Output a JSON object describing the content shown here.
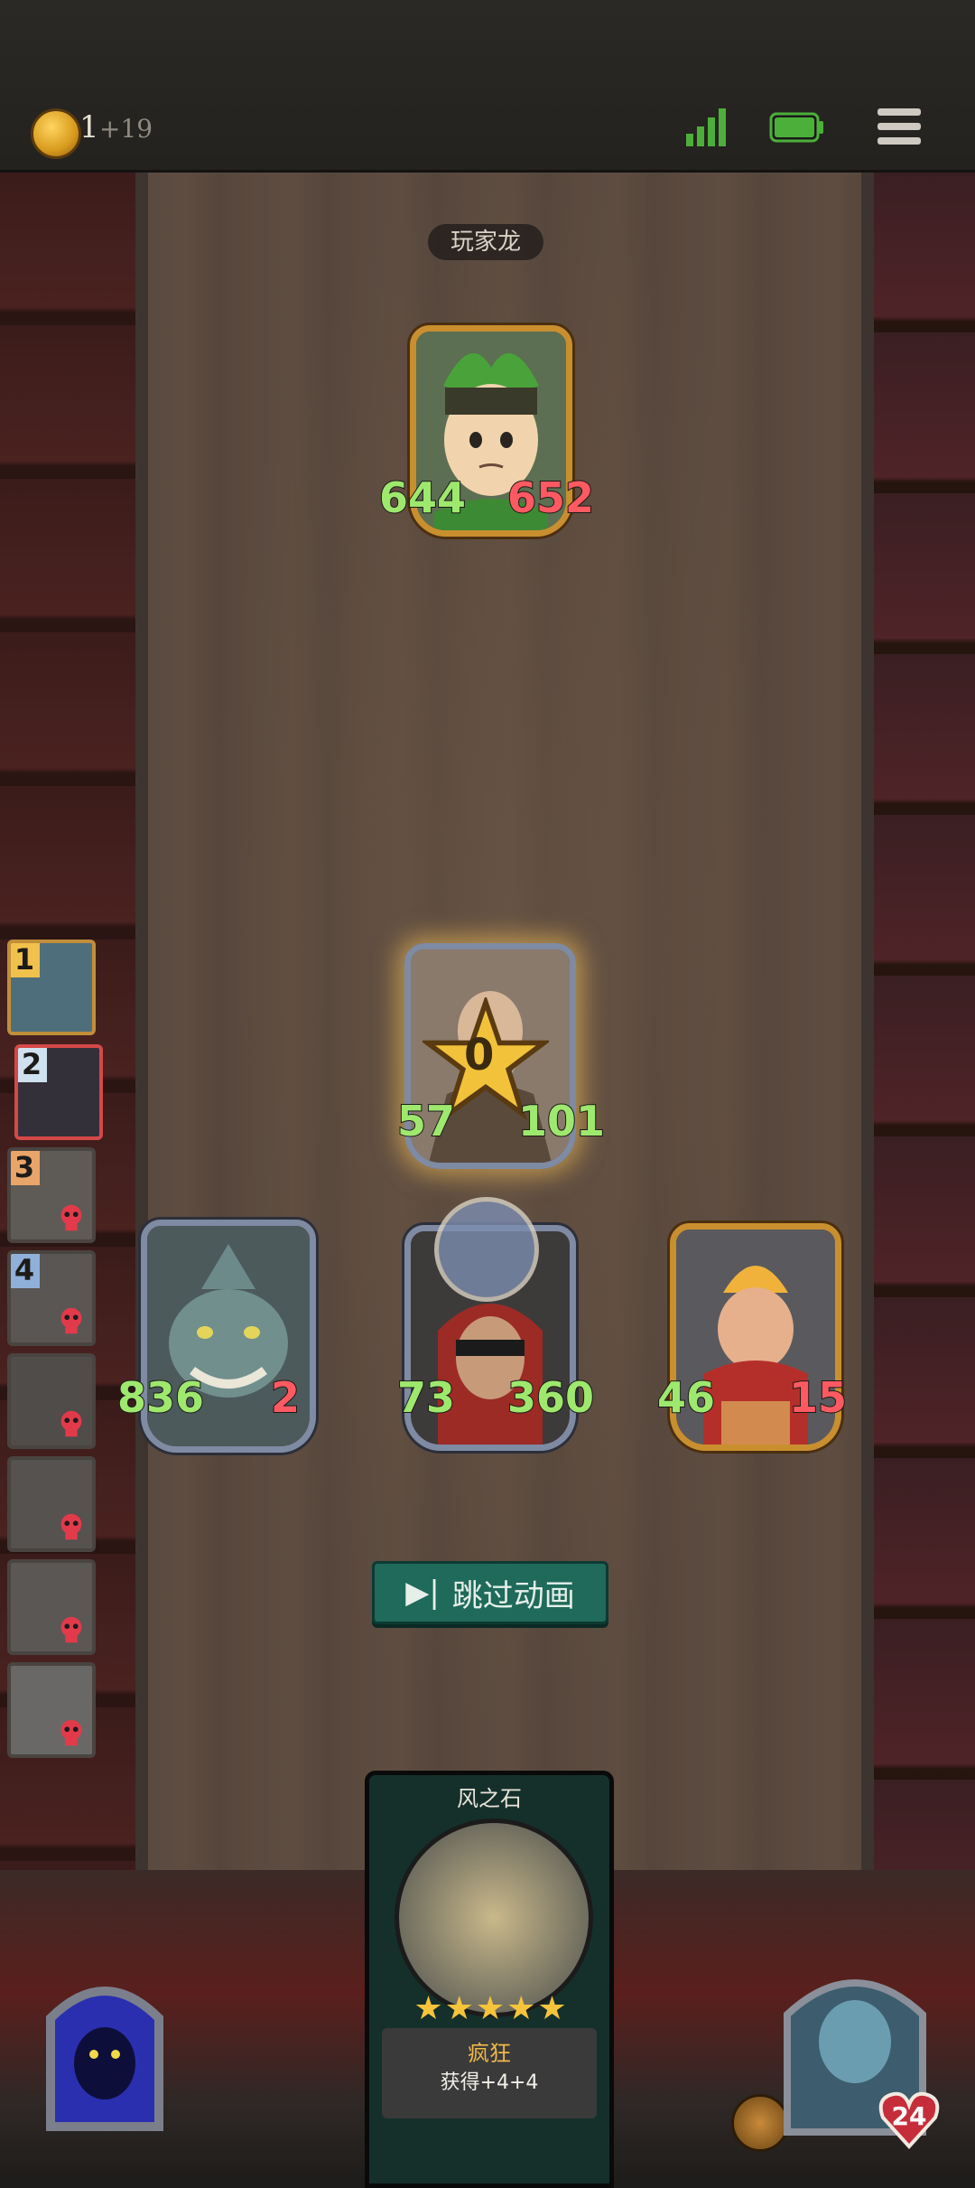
{
  "top_bar": {
    "coins": "1",
    "coin_income": "+19"
  },
  "board": {
    "player_name": "玩家龙"
  },
  "opponent": {
    "attack": "644",
    "health": "652"
  },
  "center_card": {
    "attack": "57",
    "health": "101",
    "star_value": "0"
  },
  "units": [
    {
      "name": "shark-warrior",
      "attack": "836",
      "health": "2"
    },
    {
      "name": "masked-rogue",
      "attack": "73",
      "health": "360"
    },
    {
      "name": "red-scarf-fighter",
      "attack": "46",
      "health": "15"
    }
  ],
  "skip_button": {
    "label": "跳过动画"
  },
  "roster": [
    {
      "num": "1",
      "state": "alive"
    },
    {
      "num": "2",
      "state": "active"
    },
    {
      "num": "3",
      "state": "dead"
    },
    {
      "num": "4",
      "state": "dead"
    },
    {
      "num": "",
      "state": "dead"
    },
    {
      "num": "",
      "state": "dead"
    },
    {
      "num": "",
      "state": "dead"
    },
    {
      "num": "",
      "state": "dead"
    }
  ],
  "item_card": {
    "title": "风之石",
    "stars": "★★★★★",
    "effect": "疯狂",
    "description": "获得+4+4"
  },
  "hero": {
    "health": "24"
  },
  "colors": {
    "attack": "#9ee86e",
    "health": "#ff5a62",
    "button": "#1f6a5a"
  }
}
